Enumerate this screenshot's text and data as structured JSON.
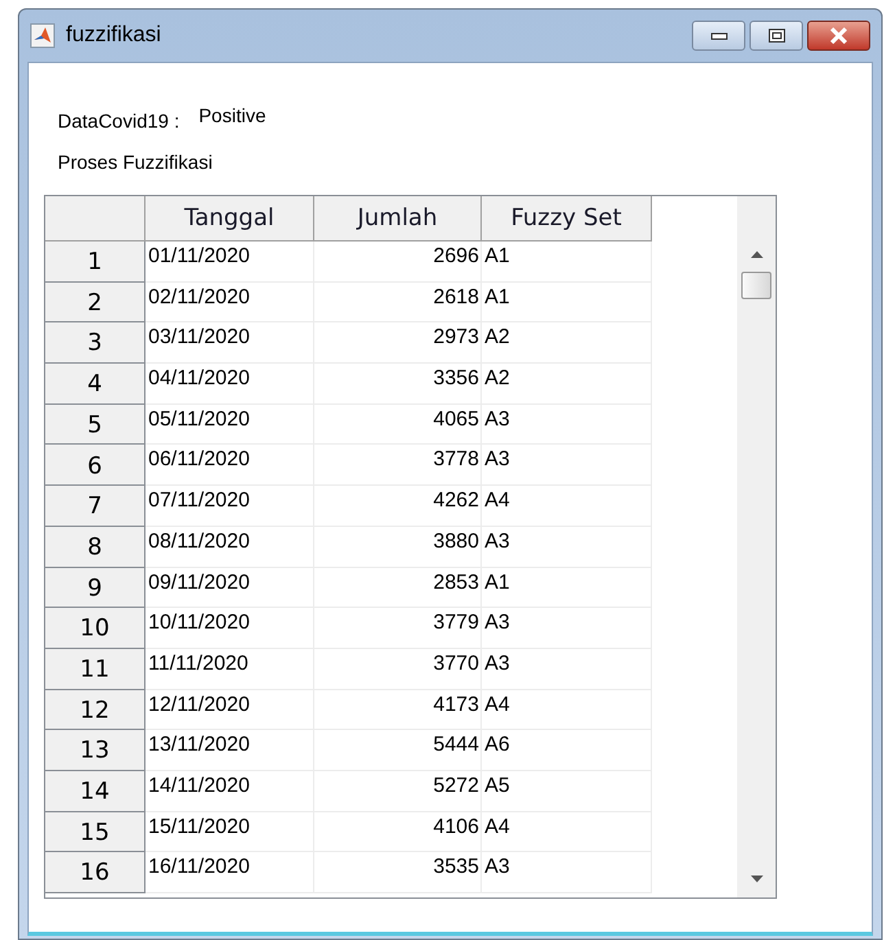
{
  "window": {
    "title": "fuzzifikasi"
  },
  "data_label": "DataCovid19 :",
  "data_value": "Positive",
  "section_title": "Proses Fuzzifikasi",
  "table": {
    "columns": [
      "Tanggal",
      "Jumlah",
      "Fuzzy Set"
    ],
    "rows": [
      {
        "index": "1",
        "tanggal": "01/11/2020",
        "jumlah": "2696",
        "fuzzy_set": "A1"
      },
      {
        "index": "2",
        "tanggal": "02/11/2020",
        "jumlah": "2618",
        "fuzzy_set": "A1"
      },
      {
        "index": "3",
        "tanggal": "03/11/2020",
        "jumlah": "2973",
        "fuzzy_set": "A2"
      },
      {
        "index": "4",
        "tanggal": "04/11/2020",
        "jumlah": "3356",
        "fuzzy_set": "A2"
      },
      {
        "index": "5",
        "tanggal": "05/11/2020",
        "jumlah": "4065",
        "fuzzy_set": "A3"
      },
      {
        "index": "6",
        "tanggal": "06/11/2020",
        "jumlah": "3778",
        "fuzzy_set": "A3"
      },
      {
        "index": "7",
        "tanggal": "07/11/2020",
        "jumlah": "4262",
        "fuzzy_set": "A4"
      },
      {
        "index": "8",
        "tanggal": "08/11/2020",
        "jumlah": "3880",
        "fuzzy_set": "A3"
      },
      {
        "index": "9",
        "tanggal": "09/11/2020",
        "jumlah": "2853",
        "fuzzy_set": "A1"
      },
      {
        "index": "10",
        "tanggal": "10/11/2020",
        "jumlah": "3779",
        "fuzzy_set": "A3"
      },
      {
        "index": "11",
        "tanggal": "11/11/2020",
        "jumlah": "3770",
        "fuzzy_set": "A3"
      },
      {
        "index": "12",
        "tanggal": "12/11/2020",
        "jumlah": "4173",
        "fuzzy_set": "A4"
      },
      {
        "index": "13",
        "tanggal": "13/11/2020",
        "jumlah": "5444",
        "fuzzy_set": "A6"
      },
      {
        "index": "14",
        "tanggal": "14/11/2020",
        "jumlah": "5272",
        "fuzzy_set": "A5"
      },
      {
        "index": "15",
        "tanggal": "15/11/2020",
        "jumlah": "4106",
        "fuzzy_set": "A4"
      },
      {
        "index": "16",
        "tanggal": "16/11/2020",
        "jumlah": "3535",
        "fuzzy_set": "A3"
      }
    ]
  }
}
